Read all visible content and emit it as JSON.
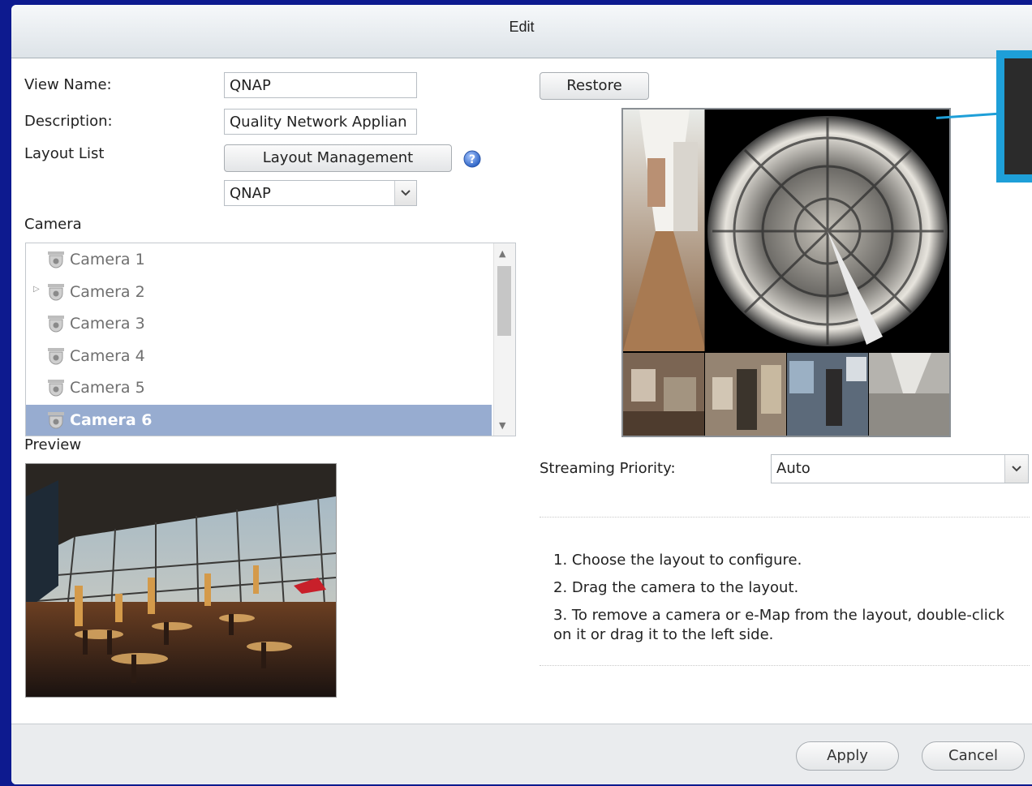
{
  "dialog": {
    "title": "Edit"
  },
  "form": {
    "view_name_label": "View Name:",
    "view_name_value": "QNAP",
    "description_label": "Description:",
    "description_value": "Quality Network Applian",
    "layout_list_label": "Layout List",
    "layout_management_label": "Layout Management",
    "layout_select_value": "QNAP",
    "restore_label": "Restore"
  },
  "camera": {
    "section_label": "Camera",
    "items": [
      {
        "label": "Camera 1"
      },
      {
        "label": "Camera 2"
      },
      {
        "label": "Camera 3"
      },
      {
        "label": "Camera 4"
      },
      {
        "label": "Camera 5"
      },
      {
        "label": "Camera 6"
      }
    ],
    "selected_index": 5
  },
  "preview": {
    "label": "Preview"
  },
  "streaming": {
    "label": "Streaming Priority:",
    "value": "Auto"
  },
  "instructions": [
    "1. Choose the layout to configure.",
    "2. Drag the camera to the layout.",
    "3. To remove a camera or e-Map from the layout, double-click on it or drag it to the left side."
  ],
  "footer": {
    "apply_label": "Apply",
    "cancel_label": "Cancel"
  },
  "colors": {
    "accent_callout": "#1e9fd8",
    "selected_row": "#97acd0",
    "backdrop": "#0d1a8f"
  }
}
